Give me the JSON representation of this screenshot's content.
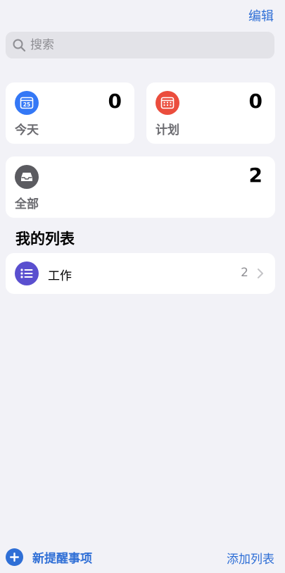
{
  "header": {
    "edit_label": "编辑"
  },
  "search": {
    "placeholder": "搜索"
  },
  "smart_lists": {
    "today": {
      "label": "今天",
      "count": "0",
      "day": "25",
      "color": "#3478f6"
    },
    "scheduled": {
      "label": "计划",
      "count": "0",
      "color": "#eb4d3d"
    },
    "all": {
      "label": "全部",
      "count": "2",
      "color": "#5b5b60"
    }
  },
  "my_lists": {
    "title": "我的列表",
    "items": [
      {
        "name": "工作",
        "count": "2",
        "color": "#5a4fcf",
        "icon": "list-bullet-icon"
      }
    ]
  },
  "footer": {
    "new_reminder_label": "新提醒事项",
    "add_list_label": "添加列表",
    "accent": "#2f6fd6"
  }
}
